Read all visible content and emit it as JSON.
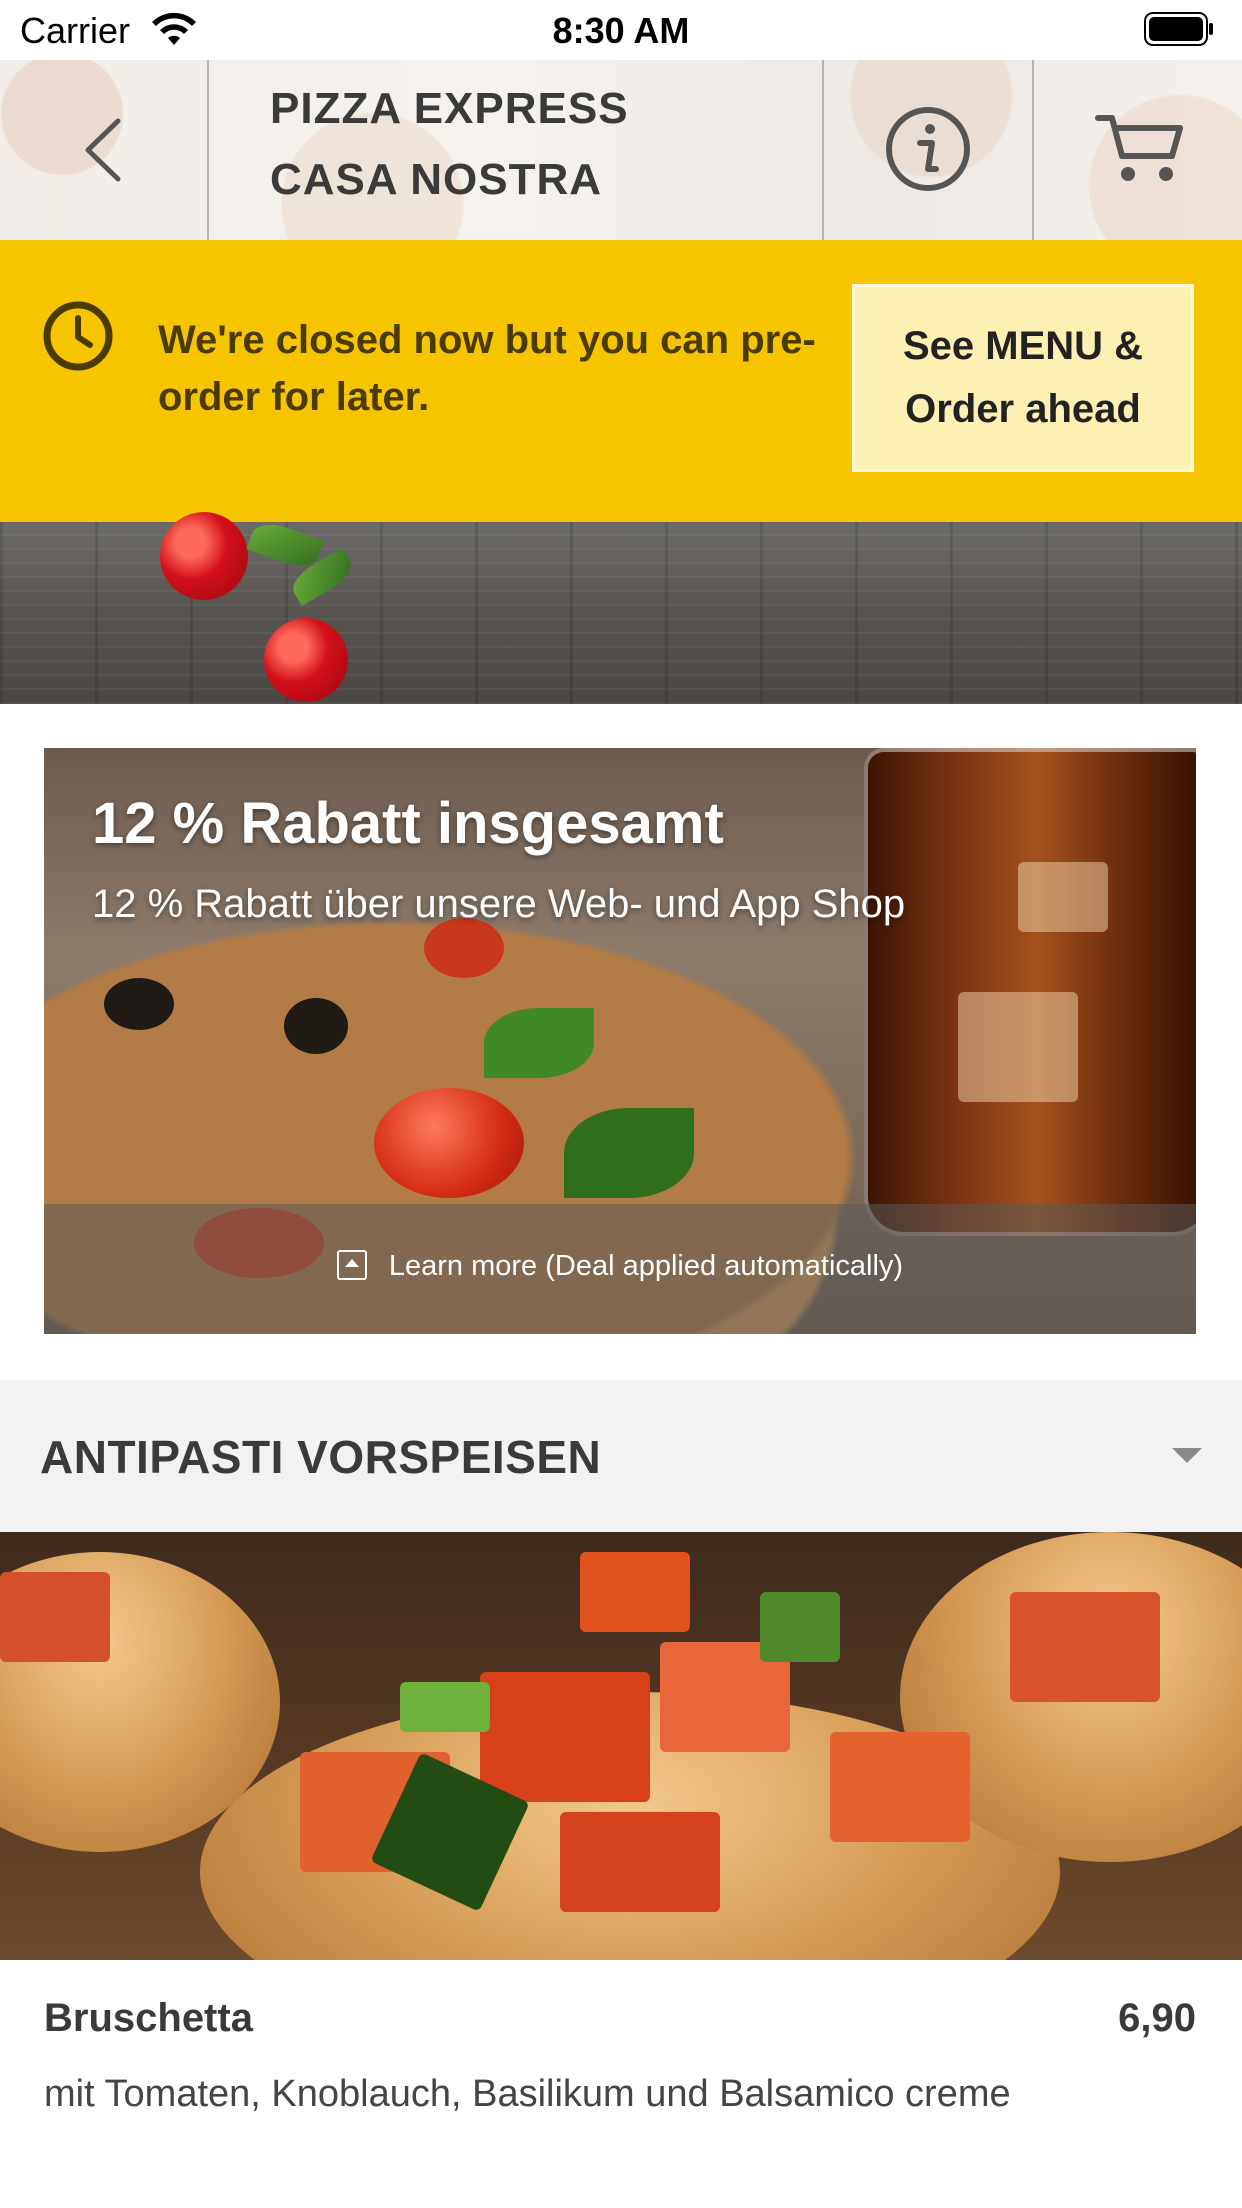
{
  "status_bar": {
    "carrier": "Carrier",
    "time": "8:30 AM",
    "icons": [
      "wifi-icon",
      "battery-icon"
    ]
  },
  "header": {
    "title_line1": "PIZZA EXPRESS",
    "title_line2": "CASA NOSTRA",
    "icons": [
      "back-chevron-icon",
      "info-icon",
      "cart-icon"
    ]
  },
  "closed_banner": {
    "message": "We're closed now but you can pre-order for later.",
    "button_label": "See MENU & Order ahead",
    "icon": "clock-icon",
    "background_color": "#f7c500"
  },
  "promo": {
    "title": "12 % Rabatt insgesamt",
    "subtitle": "12 % Rabatt über unsere Web- und App Shop",
    "learn_more": "Learn more (Deal applied automatically)",
    "icon": "expand-arrow-icon"
  },
  "menu": {
    "category": {
      "title": "ANTIPASTI VORSPEISEN",
      "icon": "chevron-down-icon"
    },
    "items": [
      {
        "name": "Bruschetta",
        "price": "6,90",
        "description": "mit Tomaten, Knoblauch, Basilikum und Balsamico creme"
      }
    ]
  }
}
